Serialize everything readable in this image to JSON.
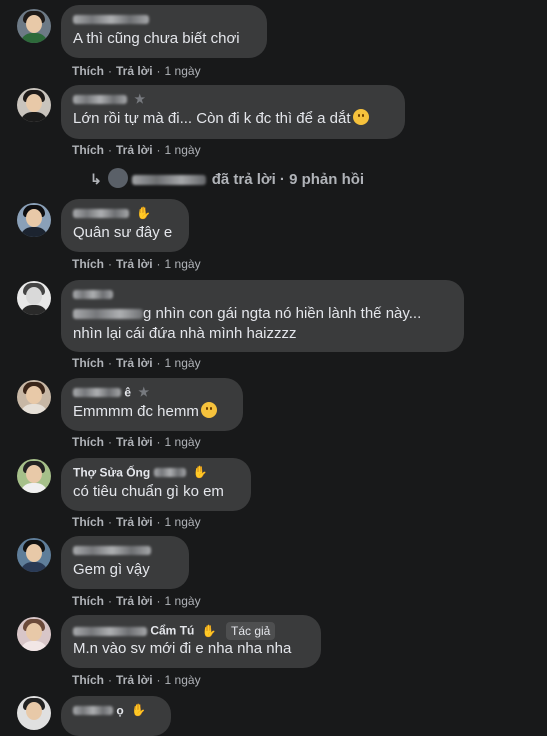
{
  "actions": {
    "like": "Thích",
    "reply": "Trả lời",
    "sep": "·"
  },
  "comments": [
    {
      "name_visible": "",
      "text": "A thì cũng chưa biết chơi",
      "time": "1 ngày"
    },
    {
      "name_visible": "",
      "text": "Lớn rồi tự mà đi... Còn đi k đc thì để a dắt",
      "time": "1 ngày",
      "replies": {
        "text": "đã trả lời · 9 phản hồi"
      }
    },
    {
      "name_visible": "",
      "text": "Quân sư đây e",
      "time": "1 ngày"
    },
    {
      "name_visible": "",
      "text_line1_suffix": "g nhìn con gái ngta nó hiền lành thế này...",
      "text_line2": "nhìn lại cái đứa nhà mình haizzzz",
      "time": "1 ngày"
    },
    {
      "name_visible": "ê",
      "text": "Emmmm đc hemm",
      "time": "1 ngày"
    },
    {
      "name_visible": "Thợ Sửa Ống",
      "text": "có tiêu chuẩn gì ko em",
      "time": "1 ngày"
    },
    {
      "name_visible": "",
      "text": "Gem gì vậy",
      "time": "1 ngày"
    },
    {
      "name_visible": "Cẩm Tú",
      "author_tag": "Tác giả",
      "text": "M.n vào sv mới đi e nha nha nha",
      "time": "1 ngày"
    },
    {
      "name_visible": "ọ"
    }
  ],
  "icons": {
    "star": "star-icon",
    "reply_arrow": "reply-arrow-icon",
    "emoji": "emoji-icon"
  },
  "colors": {
    "background": "#18191a",
    "bubble": "#3a3b3c",
    "text": "#e4e6eb",
    "muted": "#b0b3b8"
  }
}
